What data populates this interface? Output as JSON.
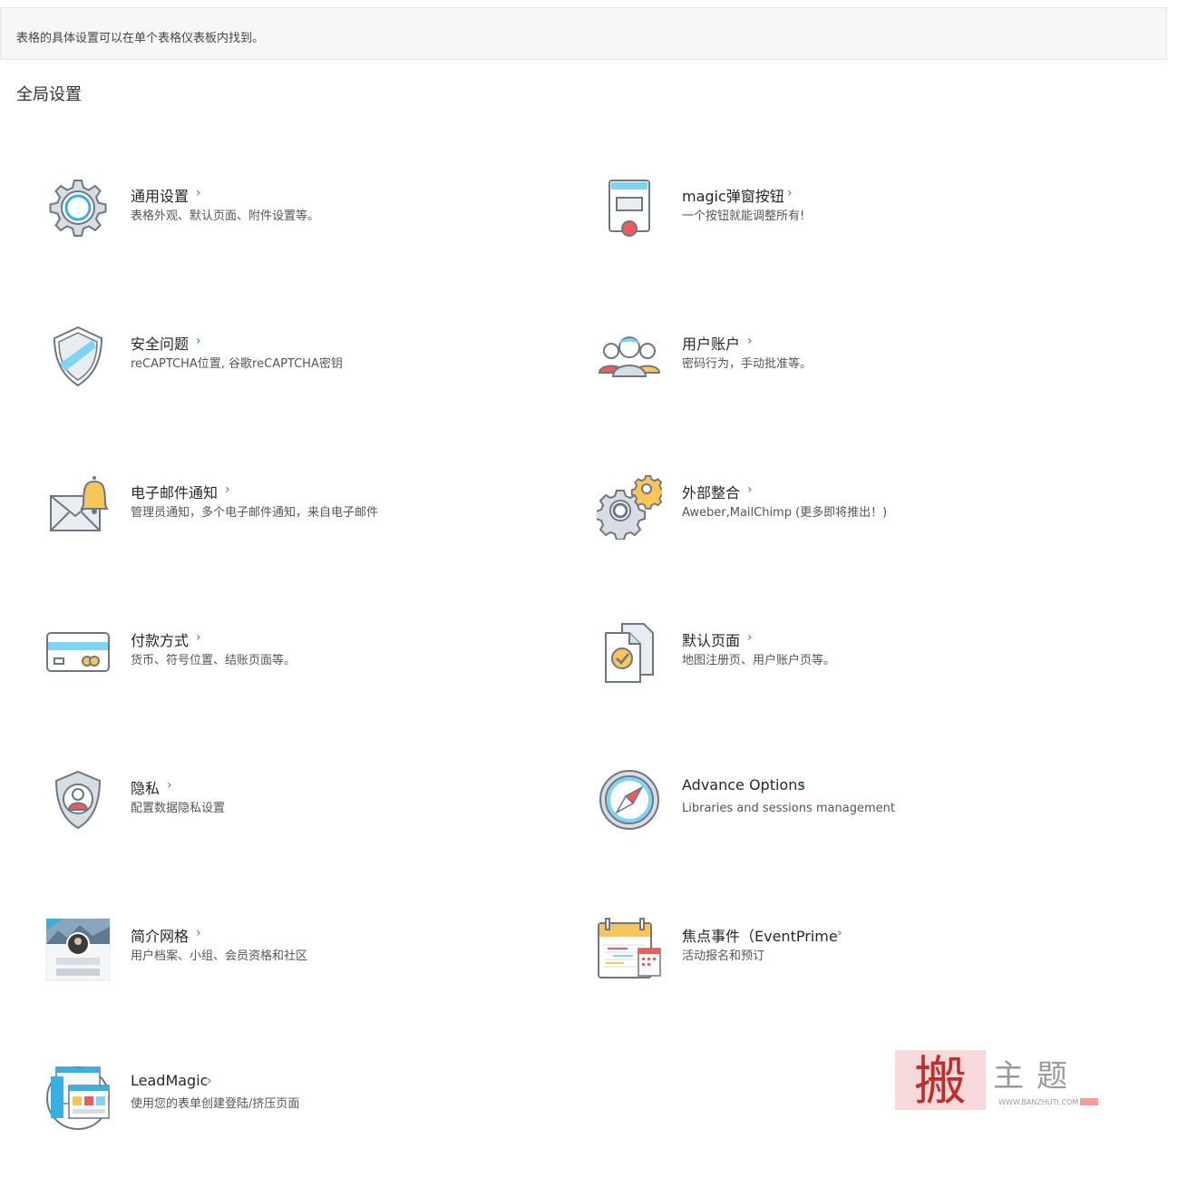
{
  "notice": {
    "text": "表格的具体设置可以在单个表格仪表板内找到。"
  },
  "section": {
    "title": "全局设置"
  },
  "cards": [
    {
      "title": "通用设置",
      "desc": "表格外观、默认页面、附件设置等。",
      "icon": "gear-icon"
    },
    {
      "title": "magic弹窗按钮",
      "desc": "一个按钮就能调整所有!",
      "icon": "popup-button-icon"
    },
    {
      "title": "安全问题",
      "desc": "reCAPTCHA位置, 谷歌reCAPTCHA密钥",
      "icon": "shield-icon"
    },
    {
      "title": "用户账户",
      "desc": "密码行为，手动批准等。",
      "icon": "users-icon"
    },
    {
      "title": "电子邮件通知",
      "desc": "管理员通知，多个电子邮件通知，来自电子邮件",
      "icon": "email-bell-icon"
    },
    {
      "title": "外部整合",
      "desc": "Aweber,MailChimp (更多即将推出！)",
      "icon": "gears-icon"
    },
    {
      "title": "付款方式",
      "desc": "货币、符号位置、结账页面等。",
      "icon": "credit-card-icon"
    },
    {
      "title": "默认页面",
      "desc": "地图注册页、用户账户页等。",
      "icon": "document-check-icon"
    },
    {
      "title": "隐私",
      "desc": "配置数据隐私设置",
      "icon": "privacy-shield-icon"
    },
    {
      "title": "Advance Options",
      "desc": "Libraries and sessions management",
      "icon": "compass-icon"
    },
    {
      "title": "简介网格",
      "desc": "用户档案、小组、会员资格和社区",
      "icon": "profile-grid-icon"
    },
    {
      "title": "焦点事件（EventPrime",
      "desc": "活动报名和预订",
      "icon": "calendar-icon"
    },
    {
      "title": "LeadMagic",
      "desc": "使用您的表单创建登陆/挤压页面",
      "icon": "leadmagic-icon"
    }
  ],
  "chevron": "›",
  "watermark": {
    "main": "搬",
    "side": "主题",
    "url": "WWW.BANZHUTI.COM"
  },
  "colors": {
    "accent": "#2a8bb7",
    "light_blue": "#7fd3f3",
    "red": "#f05a5a",
    "yellow": "#f7c65a",
    "outline": "#6e7682"
  }
}
